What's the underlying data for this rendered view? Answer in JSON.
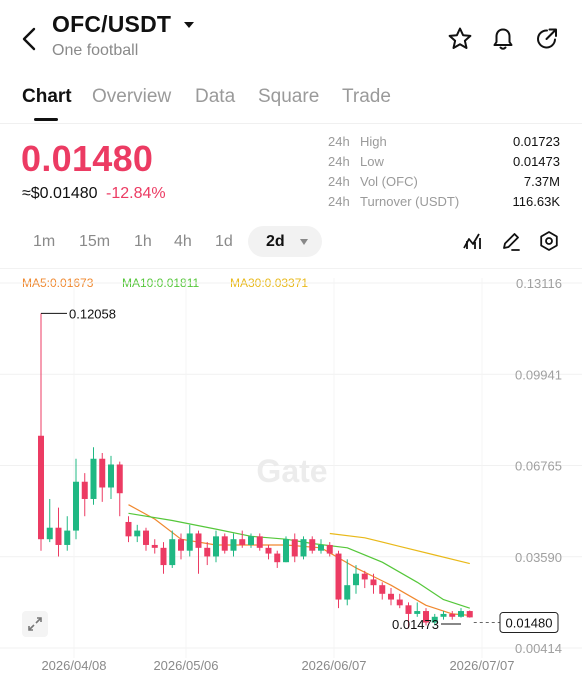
{
  "header": {
    "pair": "OFC/USDT",
    "name": "One football"
  },
  "tabs": [
    {
      "label": "Chart",
      "active": true
    },
    {
      "label": "Overview",
      "active": false
    },
    {
      "label": "Data",
      "active": false
    },
    {
      "label": "Square",
      "active": false
    },
    {
      "label": "Trade",
      "active": false
    }
  ],
  "ticker": {
    "last_price": "0.01480",
    "usd_price": "≈$0.01480",
    "change_pct": "-12.84%",
    "stats": [
      {
        "period": "24h",
        "label": "High",
        "value": "0.01723"
      },
      {
        "period": "24h",
        "label": "Low",
        "value": "0.01473"
      },
      {
        "period": "24h",
        "label": "Vol (OFC)",
        "value": "7.37M"
      },
      {
        "period": "24h",
        "label": "Turnover (USDT)",
        "value": "116.63K"
      }
    ]
  },
  "intervals": [
    "1m",
    "15m",
    "1h",
    "4h",
    "1d"
  ],
  "active_interval": "2d",
  "ma_legend": {
    "ma5": "MA5:0.01673",
    "ma10": "MA10:0.01811",
    "ma30": "MA30:0.03371"
  },
  "watermark": "Gate",
  "colors": {
    "up": "#1fb883",
    "down": "#ec3b63",
    "ma5": "#f0882e",
    "ma10": "#55c73a",
    "ma30": "#e9b91a"
  },
  "chart_data": {
    "type": "candlestick",
    "x_labels": [
      "2026/04/08",
      "2026/05/06",
      "2026/06/07",
      "2026/07/07"
    ],
    "y_ticks": [
      "0.13116",
      "0.09941",
      "0.06765",
      "0.03590",
      "0.00414"
    ],
    "ylim": [
      0.00414,
      0.13116
    ],
    "high_marker": "0.12058",
    "low_marker": "0.01473",
    "last_price_tag": "0.01480",
    "candles": [
      {
        "o": 0.078,
        "c": 0.042,
        "h": 0.1206,
        "l": 0.038
      },
      {
        "o": 0.042,
        "c": 0.046,
        "h": 0.056,
        "l": 0.041
      },
      {
        "o": 0.046,
        "c": 0.04,
        "h": 0.053,
        "l": 0.036
      },
      {
        "o": 0.04,
        "c": 0.045,
        "h": 0.05,
        "l": 0.038
      },
      {
        "o": 0.045,
        "c": 0.062,
        "h": 0.07,
        "l": 0.042
      },
      {
        "o": 0.062,
        "c": 0.056,
        "h": 0.065,
        "l": 0.05
      },
      {
        "o": 0.056,
        "c": 0.07,
        "h": 0.074,
        "l": 0.054
      },
      {
        "o": 0.07,
        "c": 0.06,
        "h": 0.072,
        "l": 0.055
      },
      {
        "o": 0.06,
        "c": 0.068,
        "h": 0.071,
        "l": 0.056
      },
      {
        "o": 0.068,
        "c": 0.058,
        "h": 0.069,
        "l": 0.05
      },
      {
        "o": 0.048,
        "c": 0.043,
        "h": 0.05,
        "l": 0.041
      },
      {
        "o": 0.043,
        "c": 0.045,
        "h": 0.047,
        "l": 0.041
      },
      {
        "o": 0.045,
        "c": 0.04,
        "h": 0.046,
        "l": 0.038
      },
      {
        "o": 0.04,
        "c": 0.039,
        "h": 0.042,
        "l": 0.037
      },
      {
        "o": 0.039,
        "c": 0.033,
        "h": 0.041,
        "l": 0.03
      },
      {
        "o": 0.033,
        "c": 0.042,
        "h": 0.045,
        "l": 0.032
      },
      {
        "o": 0.042,
        "c": 0.038,
        "h": 0.044,
        "l": 0.035
      },
      {
        "o": 0.038,
        "c": 0.044,
        "h": 0.047,
        "l": 0.036
      },
      {
        "o": 0.044,
        "c": 0.039,
        "h": 0.045,
        "l": 0.03
      },
      {
        "o": 0.039,
        "c": 0.036,
        "h": 0.041,
        "l": 0.033
      },
      {
        "o": 0.036,
        "c": 0.043,
        "h": 0.045,
        "l": 0.034
      },
      {
        "o": 0.043,
        "c": 0.038,
        "h": 0.044,
        "l": 0.037
      },
      {
        "o": 0.038,
        "c": 0.042,
        "h": 0.044,
        "l": 0.036
      },
      {
        "o": 0.042,
        "c": 0.04,
        "h": 0.045,
        "l": 0.039
      },
      {
        "o": 0.04,
        "c": 0.043,
        "h": 0.044,
        "l": 0.039
      },
      {
        "o": 0.043,
        "c": 0.039,
        "h": 0.044,
        "l": 0.038
      },
      {
        "o": 0.039,
        "c": 0.037,
        "h": 0.04,
        "l": 0.035
      },
      {
        "o": 0.037,
        "c": 0.034,
        "h": 0.038,
        "l": 0.032
      },
      {
        "o": 0.034,
        "c": 0.042,
        "h": 0.043,
        "l": 0.034
      },
      {
        "o": 0.042,
        "c": 0.036,
        "h": 0.044,
        "l": 0.034
      },
      {
        "o": 0.036,
        "c": 0.042,
        "h": 0.043,
        "l": 0.035
      },
      {
        "o": 0.042,
        "c": 0.038,
        "h": 0.043,
        "l": 0.037
      },
      {
        "o": 0.038,
        "c": 0.04,
        "h": 0.042,
        "l": 0.037
      },
      {
        "o": 0.04,
        "c": 0.037,
        "h": 0.041,
        "l": 0.036
      },
      {
        "o": 0.037,
        "c": 0.021,
        "h": 0.038,
        "l": 0.018
      },
      {
        "o": 0.021,
        "c": 0.026,
        "h": 0.035,
        "l": 0.019
      },
      {
        "o": 0.026,
        "c": 0.03,
        "h": 0.033,
        "l": 0.023
      },
      {
        "o": 0.03,
        "c": 0.028,
        "h": 0.031,
        "l": 0.025
      },
      {
        "o": 0.028,
        "c": 0.026,
        "h": 0.03,
        "l": 0.023
      },
      {
        "o": 0.026,
        "c": 0.023,
        "h": 0.027,
        "l": 0.021
      },
      {
        "o": 0.023,
        "c": 0.021,
        "h": 0.025,
        "l": 0.019
      },
      {
        "o": 0.021,
        "c": 0.019,
        "h": 0.023,
        "l": 0.018
      },
      {
        "o": 0.019,
        "c": 0.016,
        "h": 0.02,
        "l": 0.011
      },
      {
        "o": 0.016,
        "c": 0.017,
        "h": 0.02,
        "l": 0.015
      },
      {
        "o": 0.017,
        "c": 0.013,
        "h": 0.018,
        "l": 0.012
      },
      {
        "o": 0.013,
        "c": 0.015,
        "h": 0.016,
        "l": 0.012
      },
      {
        "o": 0.015,
        "c": 0.016,
        "h": 0.017,
        "l": 0.014
      },
      {
        "o": 0.016,
        "c": 0.015,
        "h": 0.017,
        "l": 0.014
      },
      {
        "o": 0.015,
        "c": 0.017,
        "h": 0.018,
        "l": 0.0147
      },
      {
        "o": 0.017,
        "c": 0.0148,
        "h": 0.0172,
        "l": 0.0147
      }
    ],
    "ma_series": [
      {
        "name": "MA5",
        "points": [
          [
            10,
            0.054
          ],
          [
            13,
            0.049
          ],
          [
            16,
            0.042
          ],
          [
            20,
            0.04
          ],
          [
            24,
            0.04
          ],
          [
            28,
            0.04
          ],
          [
            32,
            0.039
          ],
          [
            36,
            0.032
          ],
          [
            40,
            0.026
          ],
          [
            44,
            0.019
          ],
          [
            47,
            0.016
          ],
          [
            49,
            0.0155
          ]
        ]
      },
      {
        "name": "MA10",
        "points": [
          [
            10,
            0.051
          ],
          [
            15,
            0.0485
          ],
          [
            20,
            0.0455
          ],
          [
            24,
            0.043
          ],
          [
            28,
            0.042
          ],
          [
            31,
            0.0405
          ],
          [
            35,
            0.039
          ],
          [
            39,
            0.034
          ],
          [
            43,
            0.027
          ],
          [
            46,
            0.021
          ],
          [
            49,
            0.018
          ]
        ]
      },
      {
        "name": "MA30",
        "points": [
          [
            33,
            0.044
          ],
          [
            37,
            0.0425
          ],
          [
            41,
            0.0395
          ],
          [
            45,
            0.0365
          ],
          [
            49,
            0.0335
          ]
        ]
      }
    ]
  }
}
